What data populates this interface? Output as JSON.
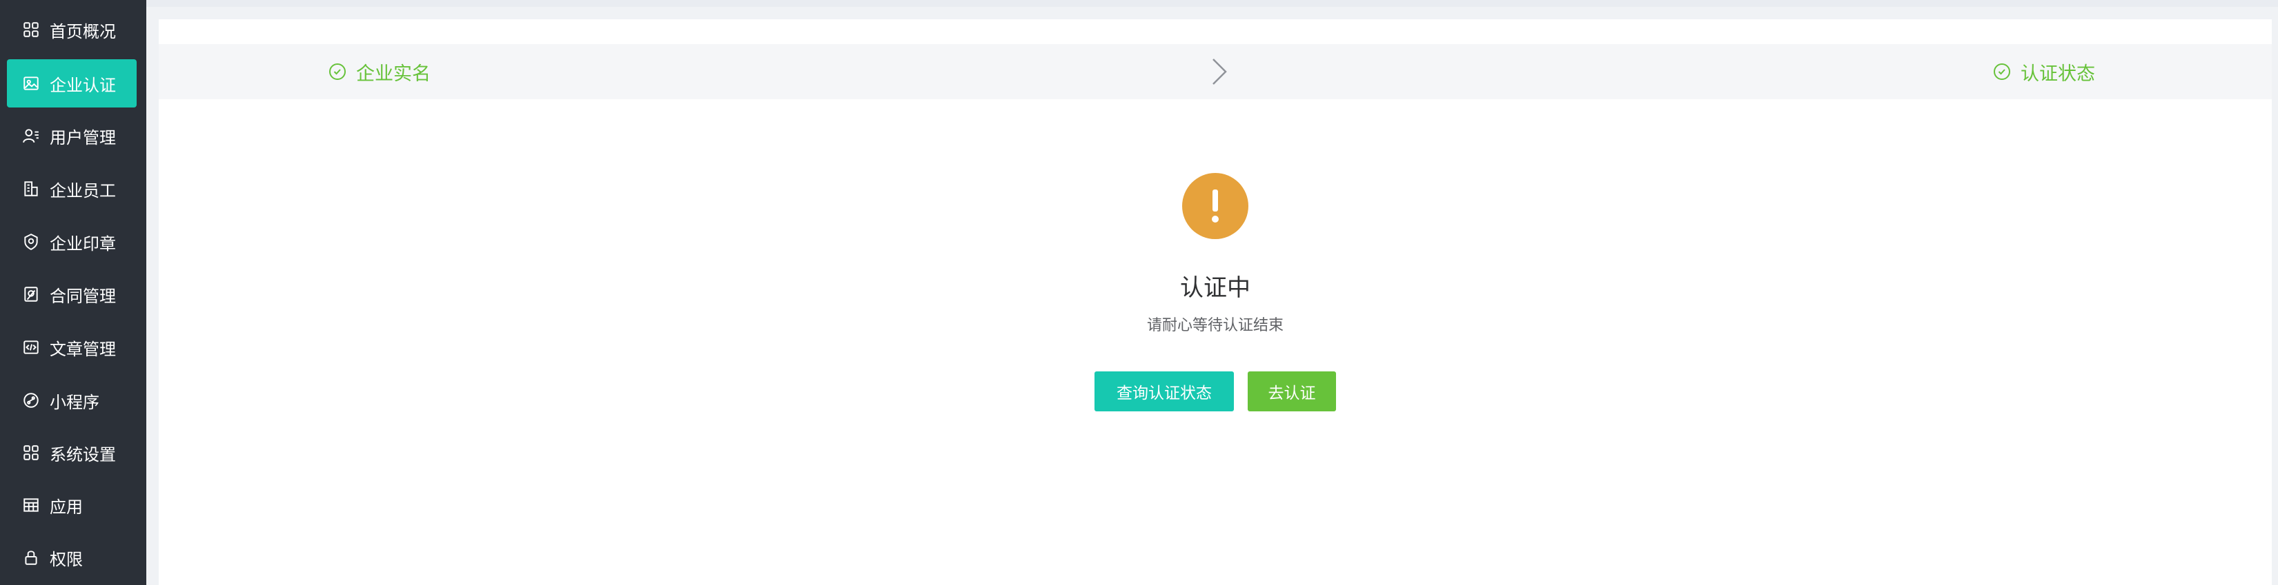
{
  "sidebar": {
    "items": [
      {
        "label": "首页概况",
        "icon": "grid-icon"
      },
      {
        "label": "企业认证",
        "icon": "id-card-icon",
        "active": true
      },
      {
        "label": "用户管理",
        "icon": "user-list-icon"
      },
      {
        "label": "企业员工",
        "icon": "building-icon"
      },
      {
        "label": "企业印章",
        "icon": "seal-icon"
      },
      {
        "label": "合同管理",
        "icon": "contract-icon"
      },
      {
        "label": "文章管理",
        "icon": "code-doc-icon"
      },
      {
        "label": "小程序",
        "icon": "mini-program-icon"
      },
      {
        "label": "系统设置",
        "icon": "settings-grid-icon"
      },
      {
        "label": "应用",
        "icon": "app-table-icon"
      },
      {
        "label": "权限",
        "icon": "lock-icon"
      }
    ]
  },
  "steps": {
    "step1": "企业实名",
    "step2": "认证状态"
  },
  "result": {
    "title": "认证中",
    "subtitle": "请耐心等待认证结束",
    "query_button": "查询认证状态",
    "go_button": "去认证"
  },
  "colors": {
    "sidebar_bg": "#2b3038",
    "accent": "#17c8b0",
    "success": "#67c23a",
    "warning": "#e6a23c"
  }
}
